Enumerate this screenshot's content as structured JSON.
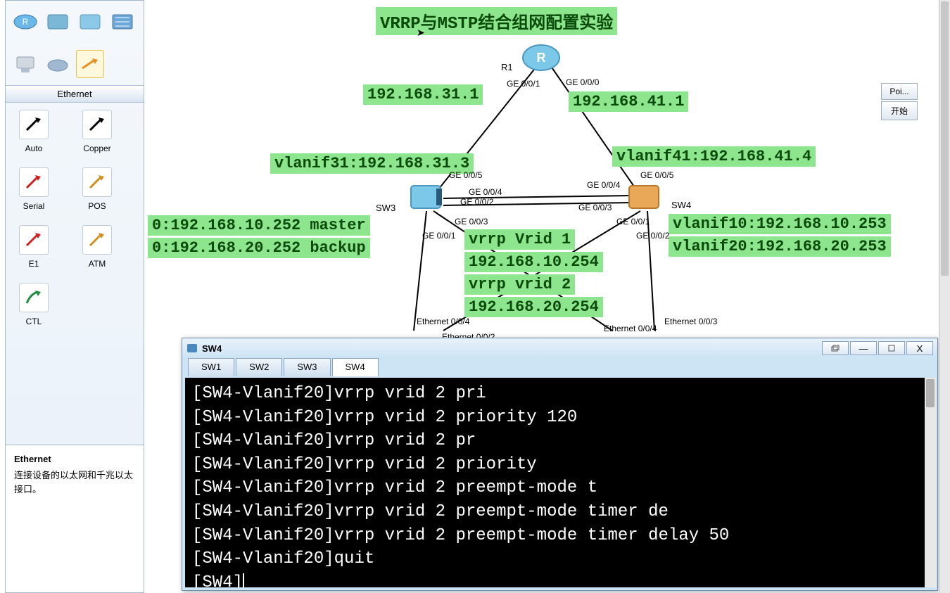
{
  "sidebar": {
    "section_label": "Ethernet",
    "tools": [
      {
        "label": "Auto"
      },
      {
        "label": "Copper"
      },
      {
        "label": "Serial"
      },
      {
        "label": "POS"
      },
      {
        "label": "E1"
      },
      {
        "label": "ATM"
      },
      {
        "label": "CTL"
      }
    ],
    "info_title": "Ethernet",
    "info_desc": "连接设备的以太网和千兆以太接口。"
  },
  "canvas": {
    "title": "VRRP与MSTP结合组网配置实验",
    "labels": {
      "ip_r1_left": "192.168.31.1",
      "ip_r1_right": "192.168.41.1",
      "vlanif31": "vlanif31:192.168.31.3",
      "vlanif41": "vlanif41:192.168.41.4",
      "sw3_l1": "0:192.168.10.252 master",
      "sw3_l2": "0:192.168.20.252 backup",
      "vrrp_l1": "vrrp Vrid 1",
      "vrrp_l2": "192.168.10.254",
      "vrrp_l3": "vrrp vrid 2",
      "vrrp_l4": "192.168.20.254",
      "sw4_l1": "vlanif10:192.168.10.253",
      "sw4_l2": "vlanif20:192.168.20.253"
    },
    "nodes": {
      "r1": "R1",
      "sw3": "SW3",
      "sw4": "SW4"
    },
    "ports": {
      "r1_p1": "GE 0/0/1",
      "r1_p0": "GE 0/0/0",
      "sw3_p5": "GE 0/0/5",
      "sw3_p4": "GE 0/0/4",
      "sw3_p2": "GE 0/0/2",
      "sw3_p3": "GE 0/0/3",
      "sw3_p1": "GE 0/0/1",
      "sw4_p5": "GE 0/0/5",
      "sw4_p4": "GE 0/0/4",
      "sw4_p3": "GE 0/0/3",
      "sw4_p1": "GE 0/0/1",
      "sw4_p2": "GE 0/0/2",
      "eth004_l": "Ethernet 0/0/4",
      "eth004_r": "Ethernet 0/0/4",
      "eth003_r": "Ethernet 0/0/3",
      "eth002": "Ethernet 0/0/2"
    }
  },
  "controls": {
    "btn1": "Poi...",
    "btn2": "开始"
  },
  "terminal": {
    "title": "SW4",
    "tabs": [
      "SW1",
      "SW2",
      "SW3",
      "SW4"
    ],
    "active_tab": 3,
    "lines": [
      "[SW4-Vlanif20]vrrp vrid 2 pri",
      "[SW4-Vlanif20]vrrp vrid 2 priority 120",
      "[SW4-Vlanif20]vrrp vrid 2 pr",
      "[SW4-Vlanif20]vrrp vrid 2 priority",
      "[SW4-Vlanif20]vrrp vrid 2 preempt-mode t",
      "[SW4-Vlanif20]vrrp vrid 2 preempt-mode timer de",
      "[SW4-Vlanif20]vrrp vrid 2 preempt-mode timer delay 50",
      "[SW4-Vlanif20]quit",
      "[SW4]"
    ]
  }
}
